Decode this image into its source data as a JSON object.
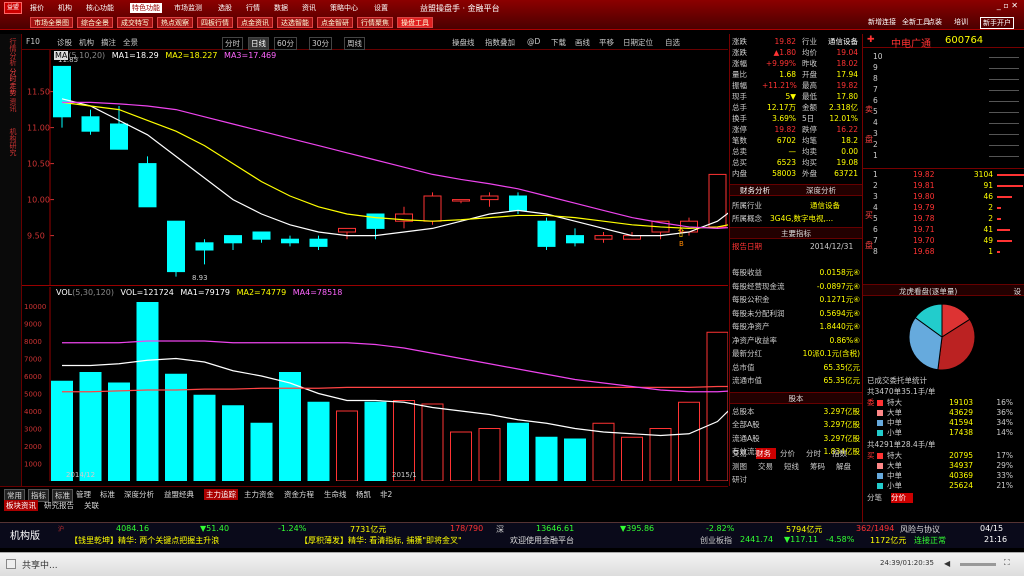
{
  "app": {
    "title": "益盟操盘手 · 金融平台",
    "logo": "益盟"
  },
  "menu": [
    "报价",
    "机构",
    "核心功能",
    "特色功能",
    "市场监测",
    "选股",
    "行情",
    "数据",
    "资讯",
    "策略中心",
    "设置"
  ],
  "toolbar_tabs": [
    "市场全景图",
    "综合全景",
    "成交特写",
    "热点观察",
    "四板行情",
    "点金资讯",
    "达选智能",
    "点金智研",
    "行情聚焦",
    "操盘工具"
  ],
  "user_btns": [
    "新增连接",
    "全新工具",
    "点装",
    "培训",
    "新手开户"
  ],
  "side_tabs": [
    "行情分析",
    "分时走势",
    "资讯",
    "机构研究"
  ],
  "chart_toolbar": {
    "left": [
      "F10",
      "诊股",
      "机构",
      "摘注",
      "全景"
    ],
    "periods": [
      "分时",
      "日线",
      "60分",
      "30分",
      "周线"
    ],
    "right": [
      "操盘线",
      "指数叠加",
      "@D",
      "下载",
      "画线",
      "平移",
      "日期定位",
      "自选"
    ]
  },
  "main_legend": {
    "title": "MA",
    "params": "(5,10,20)",
    "ma1": "MA1=18.29",
    "ma2": "MA2=18.227",
    "ma3": "MA3=17.469",
    "hl": "11.85",
    "lo": "8.93"
  },
  "vol_legend": {
    "title": "VOL",
    "params": "(5,30,120)",
    "vol": "VOL=121724",
    "ma1": "MA1=79179",
    "ma2": "MA2=74779",
    "ma4": "MA4=78518"
  },
  "price_axis": [
    "11.50",
    "11.00",
    "10.50",
    "10.00",
    "9.50"
  ],
  "vol_axis": [
    "10000",
    "9000",
    "8000",
    "7000",
    "6000",
    "5000",
    "4000",
    "3000",
    "2000",
    "1000"
  ],
  "date_axis": [
    "2014/12",
    "2015/1"
  ],
  "bottom_tabs": [
    "常用",
    "指标",
    "标准",
    "管理",
    "标准",
    "深度分析",
    "益盟经典",
    "主力追踪",
    "主力资金",
    "资金方程",
    "生命线",
    "杨凯",
    "非2"
  ],
  "bottom_tabs2": [
    "板块资讯",
    "研究报告",
    "关联"
  ],
  "stock": {
    "name": "中电广通",
    "code": "600764"
  },
  "quote_rows": [
    {
      "l": "涨跌",
      "v": "19.82",
      "l2": "行业",
      "v2": "通信设备",
      "c": "#f33"
    },
    {
      "l": "涨跌",
      "v": "▲1.80",
      "l2": "均价",
      "v2": "19.04",
      "c": "#f33"
    },
    {
      "l": "涨幅",
      "v": "+9.99%",
      "l2": "昨收",
      "v2": "18.02",
      "c": "#f33"
    },
    {
      "l": "量比",
      "v": "1.68",
      "l2": "开盘",
      "v2": "17.94",
      "c": "#ff0"
    },
    {
      "l": "振幅",
      "v": "+11.21%",
      "l2": "最高",
      "v2": "19.82",
      "c": "#f33"
    },
    {
      "l": "现手",
      "v": "5▼",
      "l2": "最低",
      "v2": "17.80",
      "c": "#ff0"
    },
    {
      "l": "总手",
      "v": "12.17万",
      "l2": "金额",
      "v2": "2.318亿",
      "c": "#ff0"
    },
    {
      "l": "换手",
      "v": "3.69%",
      "l2": "5日",
      "v2": "12.01%",
      "c": "#ff0"
    },
    {
      "l": "涨停",
      "v": "19.82",
      "l2": "跌停",
      "v2": "16.22",
      "c": "#f33"
    },
    {
      "l": "笔数",
      "v": "6702",
      "l2": "均笔",
      "v2": "18.2",
      "c": "#ff0"
    },
    {
      "l": "总卖",
      "v": "—",
      "l2": "均卖",
      "v2": "0.00",
      "c": "#ff0"
    },
    {
      "l": "总买",
      "v": "6523",
      "l2": "均买",
      "v2": "19.08",
      "c": "#ff0"
    },
    {
      "l": "内盘",
      "v": "58003",
      "l2": "外盘",
      "v2": "63721",
      "c": "#ff0"
    }
  ],
  "fin_tabs": [
    "财务分析",
    "深度分析"
  ],
  "industry": {
    "l1": "所属行业",
    "v1": "通信设备",
    "l2": "所属概念",
    "v2": "3G4G,数字电视,..."
  },
  "main_idx": {
    "title": "主要指标",
    "report": "报告日期",
    "date": "2014/12/31"
  },
  "fin_rows": [
    {
      "l": "每股收益",
      "v": "0.0158元④"
    },
    {
      "l": "每股经营现金流",
      "v": "-0.0897元④"
    },
    {
      "l": "每股公积金",
      "v": "0.1271元④"
    },
    {
      "l": "每股未分配利润",
      "v": "0.5694元④"
    },
    {
      "l": "每股净资产",
      "v": "1.8440元④"
    },
    {
      "l": "净资产收益率",
      "v": "0.86%④"
    },
    {
      "l": "最新分红",
      "v": "10派0.1元(含税)"
    },
    {
      "l": "总市值",
      "v": "65.35亿元"
    },
    {
      "l": "流通市值",
      "v": "65.35亿元"
    }
  ],
  "equity": {
    "title": "股本",
    "rows": [
      {
        "l": "总股本",
        "v": "3.297亿股"
      },
      {
        "l": "全部A股",
        "v": "3.297亿股"
      },
      {
        "l": "流通A股",
        "v": "3.297亿股"
      },
      {
        "l": "有效流通A股",
        "v": "1.834亿股"
      }
    ]
  },
  "rp1_tabs": [
    "交易",
    "财务",
    "分价",
    "分时",
    "指数",
    "测图",
    "交易",
    "短线",
    "筹码",
    "解盘",
    "研讨"
  ],
  "orderbook": {
    "sell": [
      {
        "n": "10",
        "p": "",
        "v": ""
      },
      {
        "n": "9",
        "p": "",
        "v": ""
      },
      {
        "n": "8",
        "p": "",
        "v": ""
      },
      {
        "n": "7",
        "p": "",
        "v": ""
      },
      {
        "n": "6",
        "p": "",
        "v": ""
      },
      {
        "n": "5",
        "p": "",
        "v": ""
      },
      {
        "n": "4",
        "p": "",
        "v": ""
      },
      {
        "n": "3",
        "p": "",
        "v": ""
      },
      {
        "n": "2",
        "p": "",
        "v": ""
      },
      {
        "n": "1",
        "p": "",
        "v": ""
      }
    ],
    "buy": [
      {
        "n": "1",
        "p": "19.82",
        "v": "3104"
      },
      {
        "n": "2",
        "p": "19.81",
        "v": "91"
      },
      {
        "n": "3",
        "p": "19.80",
        "v": "46"
      },
      {
        "n": "4",
        "p": "19.79",
        "v": "2"
      },
      {
        "n": "5",
        "p": "19.78",
        "v": "2"
      },
      {
        "n": "6",
        "p": "19.71",
        "v": "41"
      },
      {
        "n": "7",
        "p": "19.70",
        "v": "49"
      },
      {
        "n": "8",
        "p": "19.68",
        "v": "1"
      }
    ]
  },
  "dragon": {
    "title": "龙虎看盘(逐单量)",
    "btn": "设"
  },
  "pie": [
    {
      "v": 16,
      "c": "#d33"
    },
    {
      "v": 36,
      "c": "#b22"
    },
    {
      "v": 33,
      "c": "#6ad"
    },
    {
      "v": 15,
      "c": "#2cc"
    }
  ],
  "deals": {
    "title": "已成交委托单统计",
    "sell_hdr": "共3470单35.1手/单",
    "buy_hdr": "共4291单28.4手/单",
    "sell": [
      {
        "t": "特大",
        "n": "19103",
        "p": "16%"
      },
      {
        "t": "大单",
        "n": "43629",
        "p": "36%"
      },
      {
        "t": "中单",
        "n": "41594",
        "p": "34%"
      },
      {
        "t": "小单",
        "n": "17438",
        "p": "14%"
      }
    ],
    "buy": [
      {
        "t": "特大",
        "n": "20795",
        "p": "17%"
      },
      {
        "t": "大单",
        "n": "34937",
        "p": "29%"
      },
      {
        "t": "中单",
        "n": "40369",
        "p": "33%"
      },
      {
        "t": "小单",
        "n": "25624",
        "p": "21%"
      }
    ],
    "side_s": "委",
    "side_b": "买"
  },
  "rp2_tabs": [
    "分笔",
    "分价"
  ],
  "ticker_row": {
    "name": "机构版",
    "idx": "4084.16",
    "chg": "▼51.40",
    "pct": "-1.24%",
    "amt": "7731亿元",
    "cnt": "178/790",
    "name2": "深",
    "idx2": "13646.61",
    "chg2": "▼395.86",
    "pct2": "-2.82%",
    "amt2": "5794亿元",
    "cnt2": "362/1494",
    "risk": "风险与协议",
    "date": "04/15"
  },
  "ticker_news": {
    "n1": "【钱里乾坤】精华: 两个关键点把握主升浪",
    "n2": "【厚积薄发】精华: 看清指标, 捕獲\"即将金叉\"",
    "n3": "欢迎使用金融平台",
    "cyb": "创业板指",
    "cv": "2441.74",
    "cc": "▼117.11",
    "cp": "-4.58%",
    "ca": "1172亿元",
    "conn": "连接正常",
    "time": "21:16"
  },
  "status_bar": {
    "left": "共享中...",
    "time": "24:39/01:20:35"
  }
}
